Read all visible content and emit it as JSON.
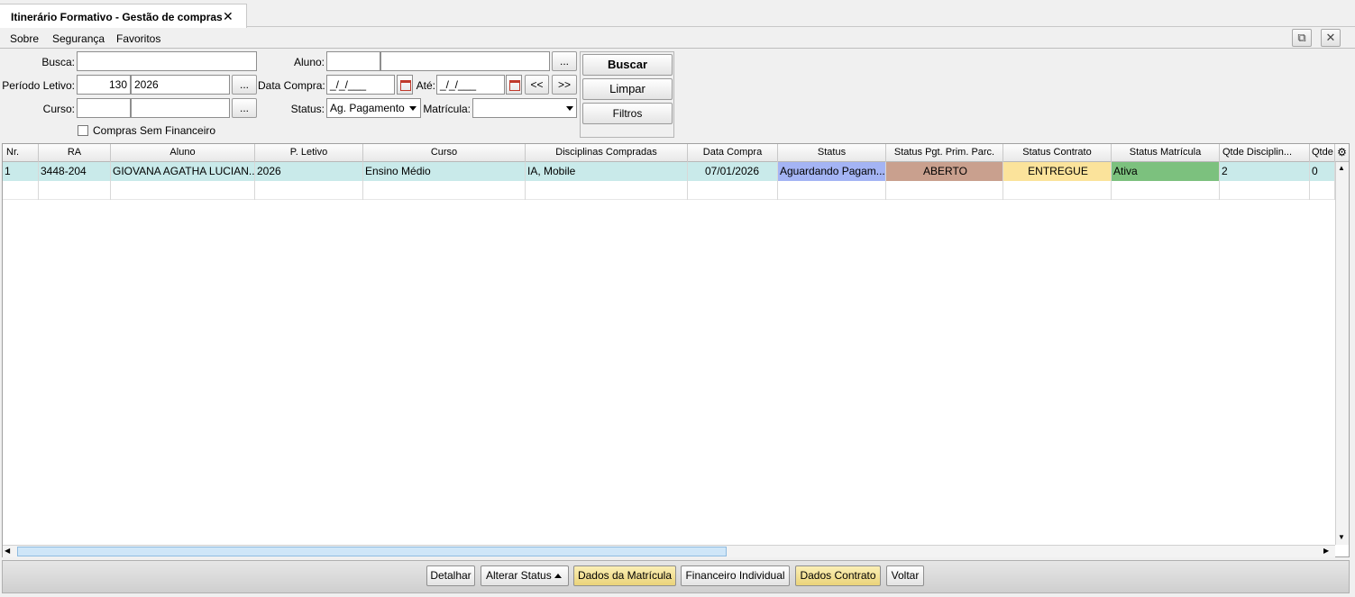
{
  "tab": {
    "title": "Itinerário Formativo - Gestão de compras",
    "close_glyph": "✕"
  },
  "menu": {
    "items": [
      "Sobre",
      "Segurança",
      "Favoritos"
    ],
    "detach_glyph": "⧉",
    "close_glyph": "✕"
  },
  "filters": {
    "busca_label": "Busca:",
    "busca_value": "",
    "aluno_label": "Aluno:",
    "aluno_code": "",
    "aluno_name": "",
    "periodo_label": "Período Letivo:",
    "periodo_code": "130",
    "periodo_year": "2026",
    "data_compra_label": "Data Compra:",
    "data_compra_value": "_/_/___",
    "ate_label": "Até:",
    "ate_value": "_/_/___",
    "prev_label": "<<",
    "next_label": ">>",
    "curso_label": "Curso:",
    "curso_code": "",
    "curso_name": "",
    "status_label": "Status:",
    "status_value": "Ag. Pagamento",
    "matricula_label": "Matrícula:",
    "matricula_value": "",
    "compras_sem_financeiro_label": "Compras Sem Financeiro",
    "compras_sem_financeiro_checked": false,
    "ellipsis": "..."
  },
  "actions": {
    "buscar": "Buscar",
    "limpar": "Limpar",
    "filtros": "Filtros"
  },
  "table": {
    "columns": [
      "Nr.",
      "RA",
      "Aluno",
      "P. Letivo",
      "Curso",
      "Disciplinas Compradas",
      "Data Compra",
      "Status",
      "Status Pgt. Prim. Parc.",
      "Status Contrato",
      "Status Matrícula",
      "Qtde Disciplin...",
      "Qtde"
    ],
    "rows": [
      {
        "nr": "1",
        "ra": "3448-204",
        "aluno": "GIOVANA AGATHA LUCIAN...",
        "periodo": "2026",
        "curso": "Ensino Médio",
        "disciplinas": "IA, Mobile",
        "data_compra": "07/01/2026",
        "status": "Aguardando Pagam...",
        "status_pgt": "ABERTO",
        "status_contrato": "ENTREGUE",
        "status_matricula": "Ativa",
        "qtde_disciplinas": "2",
        "qtde": "0"
      }
    ],
    "status_colors": {
      "status": "#a4b4f4",
      "pgt": "#c9a08e",
      "contrato": "#fbe39b",
      "matricula": "#7cc17e",
      "row": "#c9eaea"
    }
  },
  "bottom": {
    "detalhar": "Detalhar",
    "alterar_status": "Alterar Status",
    "dados_matricula": "Dados da Matrícula",
    "financeiro_individual": "Financeiro Individual",
    "dados_contrato": "Dados Contrato",
    "voltar": "Voltar"
  }
}
